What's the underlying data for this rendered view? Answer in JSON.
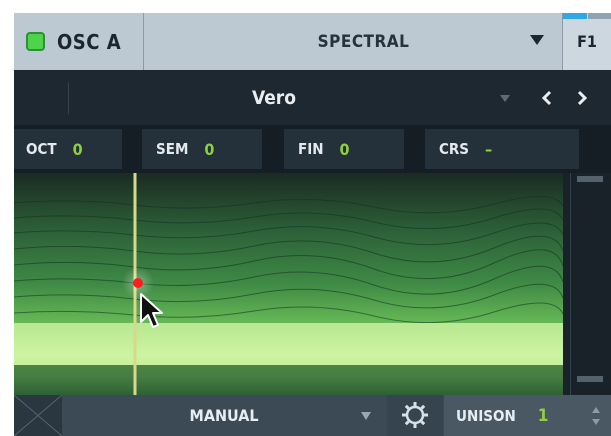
{
  "oscillator": {
    "name": "OSC A",
    "enabled": true,
    "wavetable": "SPECTRAL",
    "filter_route": "F1"
  },
  "preset": {
    "name": "Vero"
  },
  "pitch": [
    {
      "label": "OCT",
      "value": "0"
    },
    {
      "label": "SEM",
      "value": "0"
    },
    {
      "label": "FIN",
      "value": "0"
    },
    {
      "label": "CRS",
      "value": "–"
    }
  ],
  "footer": {
    "mode": "MANUAL",
    "unison_label": "UNISON",
    "unison_value": "1"
  },
  "icons": {
    "nav_prev": "chevron-left-icon",
    "nav_next": "chevron-right-icon",
    "settings": "gear-icon",
    "spinner": "up-down-arrows-icon"
  },
  "colors": {
    "enable_on": "#4ed44b",
    "value_green": "#8ed13e",
    "accent_blue": "#2fa8e6",
    "playhead": "#d9d88a",
    "marker_red": "#ff1e1e"
  }
}
